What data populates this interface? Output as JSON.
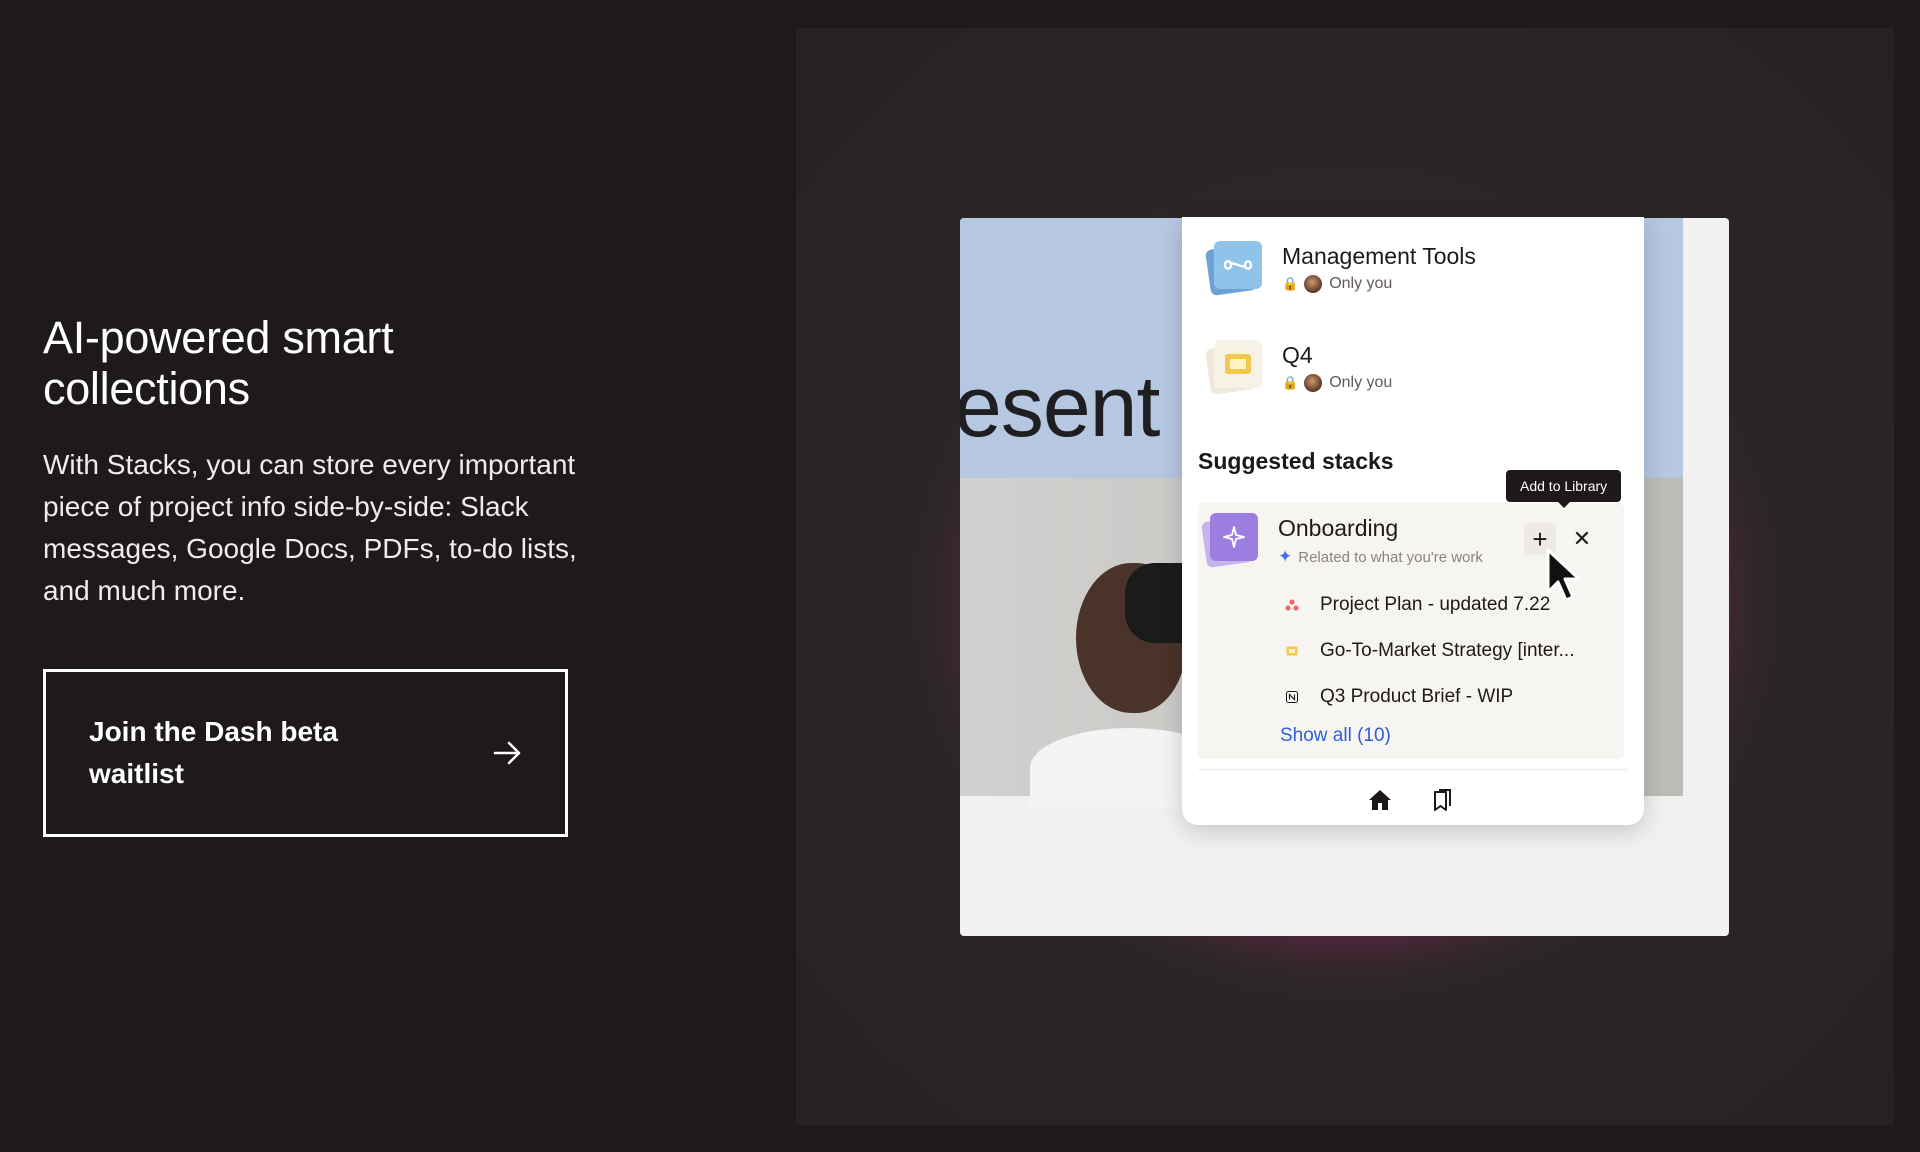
{
  "hero": {
    "headline": "AI-powered smart collections",
    "description": "With Stacks, you can store every important piece of project info side-by-side: Slack messages, Google Docs, PDFs, to-do lists, and much more.",
    "cta_label": "Join the Dash beta waitlist",
    "cta_icon": "arrow-right-icon"
  },
  "background_word": "esent",
  "stacks": [
    {
      "title": "Management Tools",
      "visibility": "Only you",
      "icon": "infinity-icon",
      "color": "#7fb8e6"
    },
    {
      "title": "Q4",
      "visibility": "Only you",
      "icon": "slides-icon",
      "color": "#f2c94c"
    }
  ],
  "suggested": {
    "section_title": "Suggested stacks",
    "stack_title": "Onboarding",
    "subtitle": "Related to what you're work",
    "tooltip": "Add to Library",
    "add_icon": "plus-icon",
    "dismiss_icon": "close-icon",
    "files": [
      {
        "name": "Project Plan - updated 7.22",
        "icon": "asana-icon"
      },
      {
        "name": "Go-To-Market Strategy [inter...",
        "icon": "slides-icon"
      },
      {
        "name": "Q3 Product Brief - WIP",
        "icon": "notion-icon"
      }
    ],
    "show_all": "Show all (10)"
  },
  "bottom_nav": [
    {
      "icon": "home-icon"
    },
    {
      "icon": "bookmark-stack-icon"
    }
  ],
  "colors": {
    "page_bg": "#1e1a1a",
    "accent_link": "#2d5fd8",
    "suggested_icon": "#9b7ee0"
  }
}
